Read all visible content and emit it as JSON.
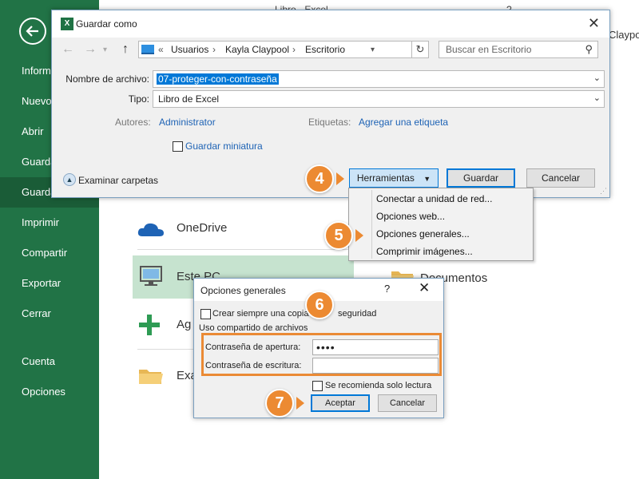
{
  "backstage": {
    "title": "Libro - Excel",
    "help": "?",
    "user": "Claypool",
    "menu": [
      "Información",
      "Nuevo",
      "Abrir",
      "Guardar",
      "Guardar como",
      "Imprimir",
      "Compartir",
      "Exportar",
      "Cerrar",
      "Cuenta",
      "Opciones"
    ],
    "menu_display": [
      "Inform",
      "Nuevo",
      "Abrir",
      "Guarda",
      "Guarda",
      "Imprimir",
      "Compartir",
      "Exportar",
      "Cerrar",
      "Cuenta",
      "Opciones"
    ],
    "places": [
      "OneDrive",
      "Este PC",
      "Ag",
      "Exa"
    ],
    "right_place": "Documentos"
  },
  "save_dialog": {
    "title": "Guardar como",
    "path": [
      "Usuarios",
      "Kayla Claypool",
      "Escritorio"
    ],
    "path_prefix": "«",
    "search_placeholder": "Buscar en Escritorio",
    "filename_label": "Nombre de archivo:",
    "filename_value": "07-proteger-con-contraseña",
    "type_label": "Tipo:",
    "type_value": "Libro de Excel",
    "authors_label": "Autores:",
    "authors_value": "Administrator",
    "tags_label": "Etiquetas:",
    "tags_value": "Agregar una etiqueta",
    "thumbnail_label": "Guardar miniatura",
    "browse_label": "Examinar carpetas",
    "tools_label": "Herramientas",
    "save_label": "Guardar",
    "cancel_label": "Cancelar"
  },
  "tools_menu": [
    "Conectar a unidad de red...",
    "Opciones web...",
    "Opciones generales...",
    "Comprimir imágenes..."
  ],
  "general_options": {
    "title": "Opciones generales",
    "help": "?",
    "backup_label": "Crear siempre una copia de seguridad",
    "backup_visible": "Crear siempre una copia",
    "backup_tail": "seguridad",
    "sharing_label": "Uso compartido de archivos",
    "open_pw_label": "Contraseña de apertura:",
    "open_pw_value": "••••",
    "modify_pw_label": "Contraseña de escritura:",
    "modify_pw_value": "",
    "readonly_label": "Se recomienda solo lectura",
    "ok_label": "Aceptar",
    "cancel_label": "Cancelar"
  },
  "steps": [
    "4",
    "5",
    "6",
    "7"
  ],
  "colors": {
    "excel_green": "#217346",
    "accent_orange": "#ec8a32",
    "selection_blue": "#0078d7"
  }
}
